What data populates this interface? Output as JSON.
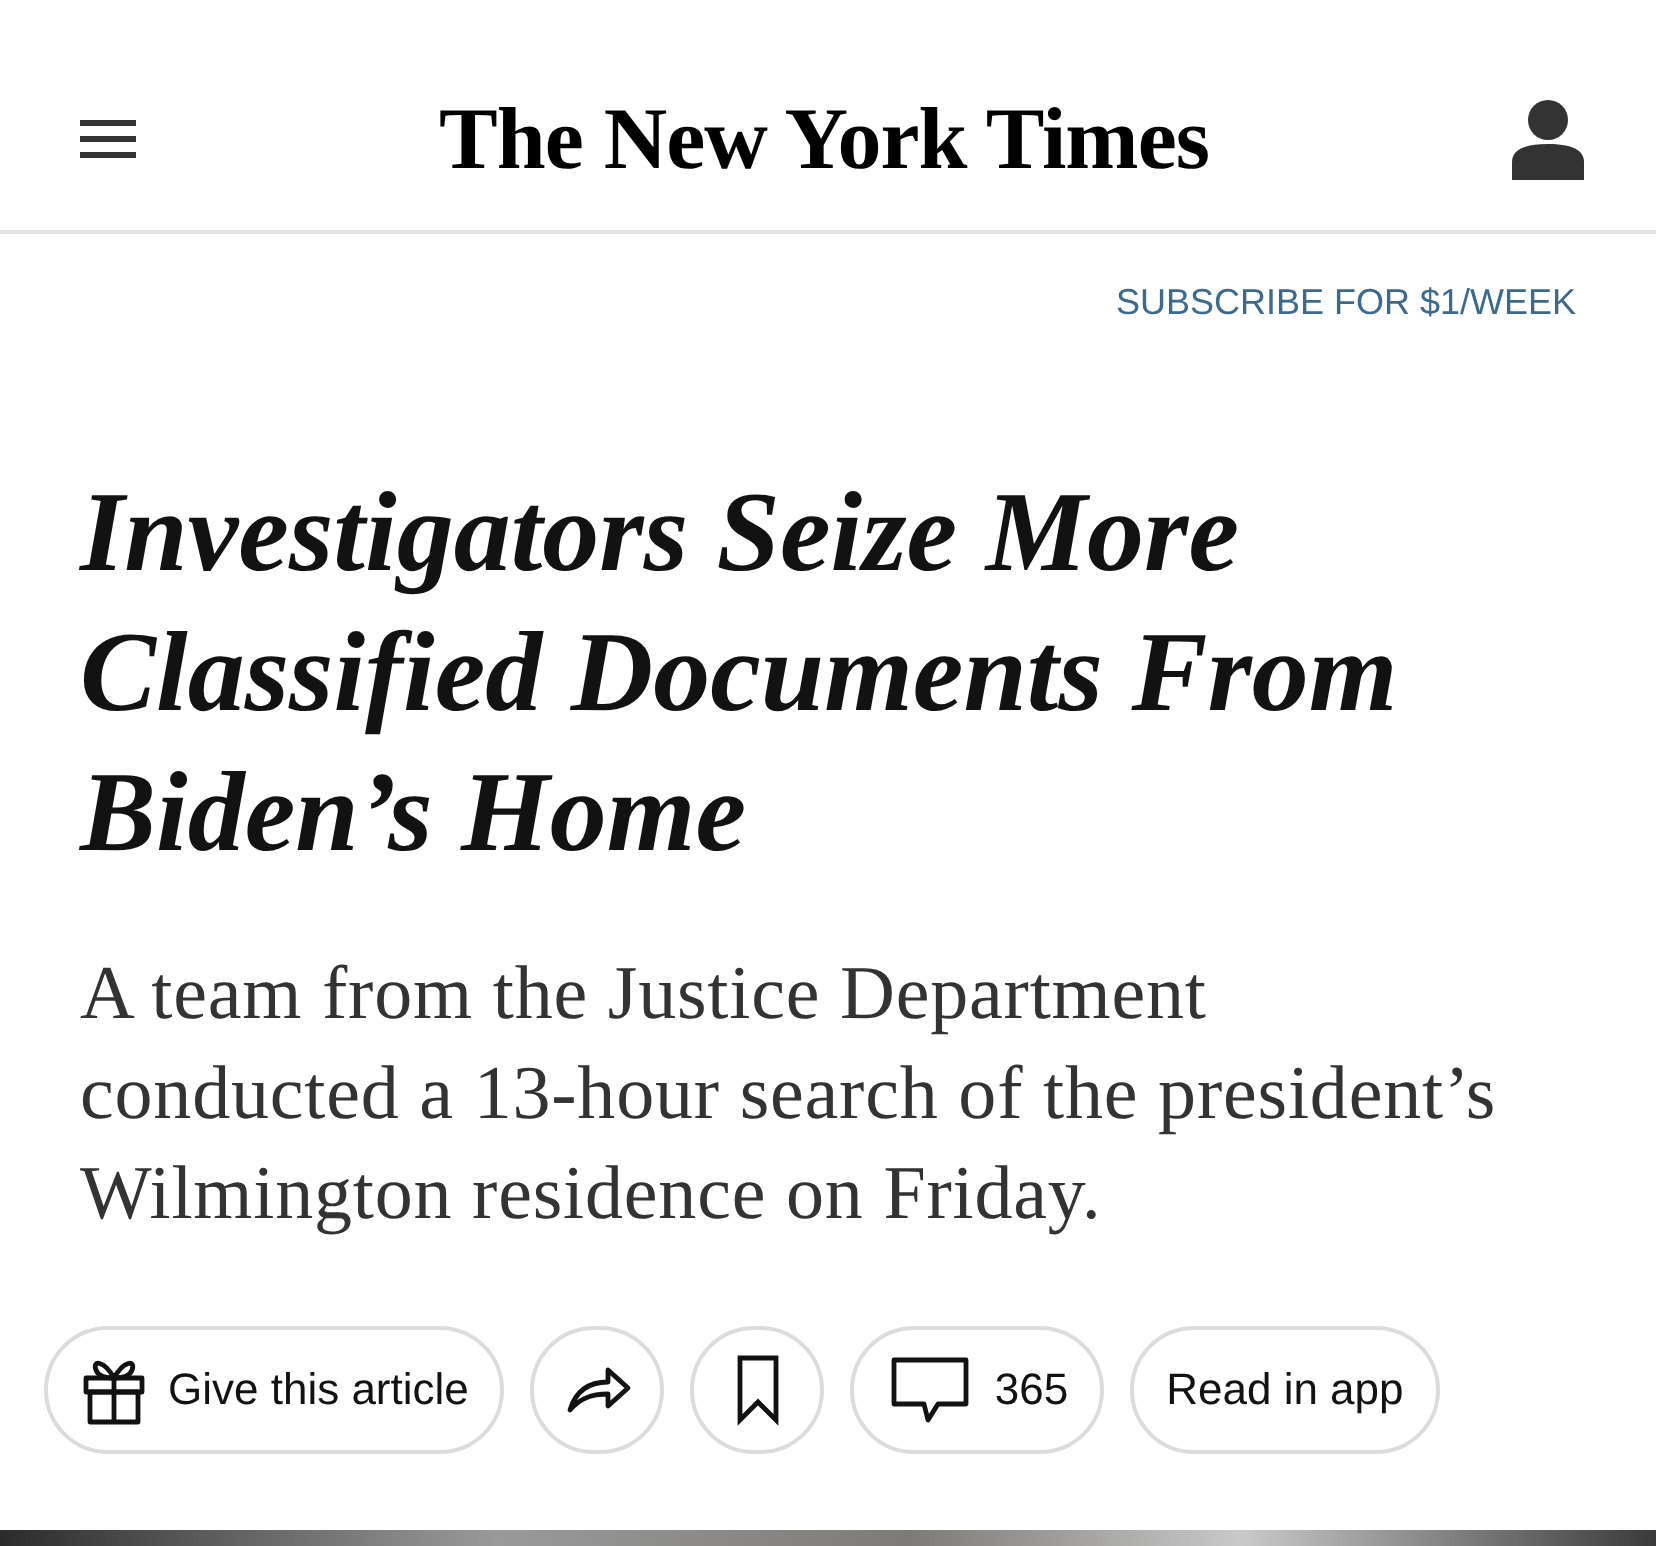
{
  "header": {
    "logo": "The New York Times"
  },
  "subscribe_link": "SUBSCRIBE FOR $1/WEEK",
  "article": {
    "headline": "Investigators Seize More Classified Documents From Biden’s Home",
    "summary": "A team from the Justice Department conducted a 13-hour search of the president’s Wilmington residence on Friday."
  },
  "actions": [
    {
      "kind": "gift",
      "label": "Give this article"
    },
    {
      "kind": "share"
    },
    {
      "kind": "save"
    },
    {
      "kind": "comments",
      "label": "365"
    },
    {
      "kind": "app",
      "label": "Read in app"
    }
  ]
}
